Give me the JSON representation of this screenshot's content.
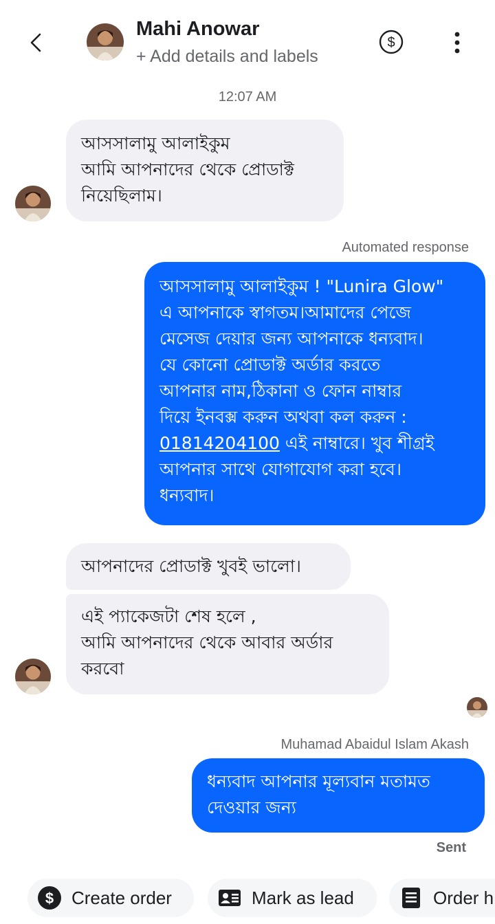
{
  "header": {
    "contact_name": "Mahi Anowar",
    "subtitle": "+ Add details and labels",
    "icons": [
      "back-arrow-icon",
      "avatar",
      "dollar-circle-icon",
      "more-vertical-icon"
    ]
  },
  "thread": {
    "timestamp": "12:07 AM",
    "messages": [
      {
        "direction": "incoming",
        "text": "আসসালামু আলাইকুম\nআমি আপনাদের থেকে প্রোডাক্ট\nনিয়েছিলাম।"
      },
      {
        "direction": "outgoing",
        "label": "Automated response",
        "text_before_link": "আসসালামু আলাইকুম ! \"Lunira Glow\"\nএ আপনাকে স্বাগতম।আমাদের পেজে\nমেসেজ দেয়ার জন্য আপনাকে ধন্যবাদ।\nযে কোনো প্রোডাক্ট  অর্ডার করতে\nআপনার নাম,ঠিকানা ও ফোন নাম্বার\nদিয়ে ইনবক্স করুন  অথবা কল করুন :\n",
        "phone_link": "01814204100",
        "text_after_link": " এই নাম্বারে।  খুব শীগ্রই\nআপনার সাথে যোগাযোগ করা হবে।\nধন্যবাদ।"
      },
      {
        "direction": "incoming",
        "text": "আপনাদের প্রোডাক্ট খুবই ভালো।"
      },
      {
        "direction": "incoming",
        "text": "এই প্যাকেজটা শেষ হলে ,\nআমি আপনাদের থেকে আবার অর্ডার\nকরবো"
      },
      {
        "direction": "outgoing",
        "label": "Muhamad Abaidul Islam Akash",
        "text": "ধন্যবাদ আপনার মূল্যবান মতামত\nদেওয়ার জন্য",
        "status": "Sent"
      }
    ]
  },
  "actions": {
    "create_order": "Create order",
    "mark_as_lead": "Mark as lead",
    "order_history": "Order h"
  },
  "colors": {
    "outgoing_bubble": "#0866ff",
    "incoming_bubble": "#f0f0f5",
    "secondary_text": "#65676b"
  }
}
